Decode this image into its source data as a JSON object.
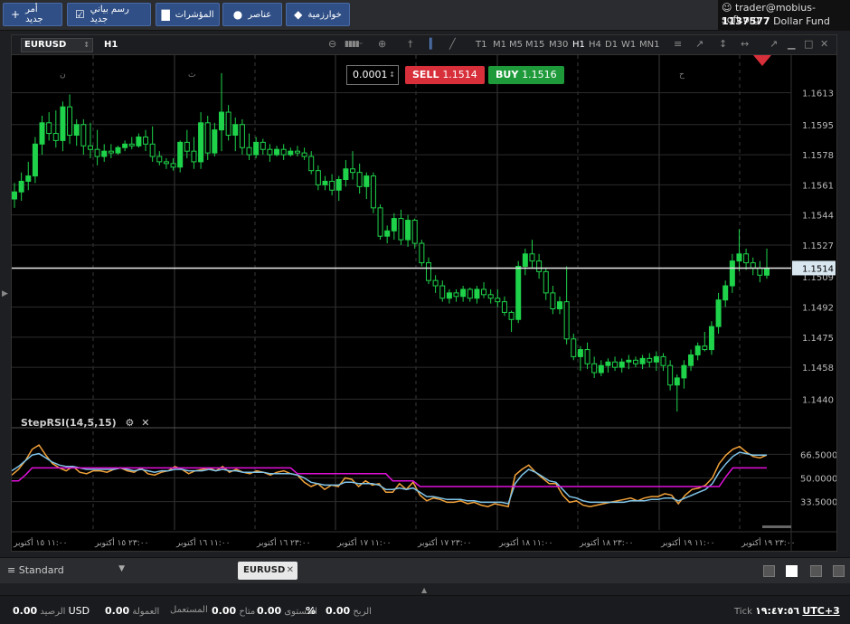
{
  "toolbar": {
    "new_order": "أمر جديد",
    "new_chart": "رسم بياني جديد",
    "indicators": "المؤشرات",
    "objects": "عناصر",
    "algorithms": "خوارزمية"
  },
  "account": {
    "user": "trader@mobius-soft.org",
    "number": "1137577",
    "name": "Dollar Fund"
  },
  "chart": {
    "symbol": "EURUSD",
    "timeframe": "H1",
    "timeframes": [
      "T1",
      "M1",
      "M5",
      "M15",
      "M30",
      "H1",
      "H4",
      "D1",
      "W1",
      "MN1"
    ],
    "active_timeframe": "H1",
    "lot": "0.0001",
    "sell_label": "SELL",
    "sell_price": "1.1514",
    "buy_label": "BUY",
    "buy_price": "1.1516",
    "current_price": "1.1514",
    "hidden_label": "1.1509",
    "day_markers": [
      "ن",
      "ث",
      "ح"
    ],
    "price_ticks": [
      "1.1613",
      "1.1595",
      "1.1578",
      "1.1561",
      "1.1544",
      "1.1527",
      "1.1492",
      "1.1475",
      "1.1458",
      "1.1440"
    ],
    "time_ticks": [
      "١١:٠٠ ١٥ أكتوبر",
      "٢٣:٠٠ ١٥ أكتوبر",
      "١١:٠٠ ١٦ أكتوبر",
      "٢٣:٠٠ ١٦ أكتوبر",
      "١١:٠٠ ١٧ أكتوبر",
      "٢٣:٠٠ ١٧ أكتوبر",
      "١١:٠٠ ١٨ أكتوبر",
      "٢٣:٠٠ ١٨ أكتوبر",
      "١١:٠٠ ١٩ أكتوبر",
      "٢٣:٠٠ ١٩ أكتوبر"
    ]
  },
  "chart_data": {
    "type": "candlestick",
    "ylim": [
      1.143,
      1.1625
    ],
    "candles": [
      [
        1.1553,
        1.1562,
        1.1548,
        1.1557
      ],
      [
        1.1557,
        1.1568,
        1.1552,
        1.1563
      ],
      [
        1.1563,
        1.1574,
        1.1558,
        1.1566
      ],
      [
        1.1566,
        1.1588,
        1.1562,
        1.1584
      ],
      [
        1.1584,
        1.16,
        1.1578,
        1.1596
      ],
      [
        1.1596,
        1.1602,
        1.1586,
        1.159
      ],
      [
        1.159,
        1.1603,
        1.1582,
        1.1586
      ],
      [
        1.1586,
        1.1608,
        1.158,
        1.1605
      ],
      [
        1.1605,
        1.1612,
        1.1584,
        1.1589
      ],
      [
        1.1589,
        1.1598,
        1.1583,
        1.1595
      ],
      [
        1.1595,
        1.1598,
        1.1578,
        1.1583
      ],
      [
        1.1583,
        1.1596,
        1.1576,
        1.1581
      ],
      [
        1.1581,
        1.1592,
        1.1572,
        1.1577
      ],
      [
        1.1577,
        1.1584,
        1.1574,
        1.158
      ],
      [
        1.158,
        1.1584,
        1.1576,
        1.1579
      ],
      [
        1.1579,
        1.1583,
        1.1578,
        1.1582
      ],
      [
        1.1582,
        1.1586,
        1.158,
        1.1584
      ],
      [
        1.1584,
        1.1588,
        1.1581,
        1.1583
      ],
      [
        1.1583,
        1.159,
        1.1582,
        1.1588
      ],
      [
        1.1588,
        1.1592,
        1.158,
        1.1584
      ],
      [
        1.1584,
        1.1594,
        1.1574,
        1.1577
      ],
      [
        1.1577,
        1.158,
        1.1572,
        1.1574
      ],
      [
        1.1574,
        1.1576,
        1.157,
        1.1573
      ],
      [
        1.1573,
        1.1576,
        1.1569,
        1.1571
      ],
      [
        1.1571,
        1.1586,
        1.1568,
        1.1585
      ],
      [
        1.1585,
        1.1592,
        1.1576,
        1.158
      ],
      [
        1.158,
        1.1588,
        1.157,
        1.1574
      ],
      [
        1.1574,
        1.1602,
        1.157,
        1.1596
      ],
      [
        1.1596,
        1.16,
        1.1575,
        1.1579
      ],
      [
        1.1579,
        1.1596,
        1.1577,
        1.1592
      ],
      [
        1.1592,
        1.1624,
        1.158,
        1.1602
      ],
      [
        1.1602,
        1.1606,
        1.1586,
        1.1589
      ],
      [
        1.1589,
        1.1599,
        1.158,
        1.1595
      ],
      [
        1.1595,
        1.1598,
        1.1578,
        1.1582
      ],
      [
        1.1582,
        1.159,
        1.1575,
        1.1578
      ],
      [
        1.1578,
        1.1588,
        1.1576,
        1.1585
      ],
      [
        1.1585,
        1.1587,
        1.1578,
        1.1581
      ],
      [
        1.1581,
        1.1584,
        1.1574,
        1.1578
      ],
      [
        1.1578,
        1.1583,
        1.1577,
        1.1581
      ],
      [
        1.1581,
        1.1584,
        1.1575,
        1.1578
      ],
      [
        1.1578,
        1.1582,
        1.1577,
        1.158
      ],
      [
        1.158,
        1.1583,
        1.1577,
        1.1579
      ],
      [
        1.1579,
        1.1582,
        1.1575,
        1.1577
      ],
      [
        1.1577,
        1.158,
        1.1567,
        1.1569
      ],
      [
        1.1569,
        1.1572,
        1.1558,
        1.1561
      ],
      [
        1.1561,
        1.1566,
        1.1558,
        1.1563
      ],
      [
        1.1563,
        1.1567,
        1.1555,
        1.1558
      ],
      [
        1.1558,
        1.1566,
        1.1552,
        1.1564
      ],
      [
        1.1564,
        1.1575,
        1.156,
        1.157
      ],
      [
        1.157,
        1.158,
        1.1564,
        1.1568
      ],
      [
        1.1568,
        1.1573,
        1.1556,
        1.156
      ],
      [
        1.156,
        1.1568,
        1.1553,
        1.1566
      ],
      [
        1.1566,
        1.1568,
        1.1545,
        1.1548
      ],
      [
        1.1548,
        1.155,
        1.153,
        1.1532
      ],
      [
        1.1532,
        1.1538,
        1.1528,
        1.1535
      ],
      [
        1.1535,
        1.1545,
        1.153,
        1.1542
      ],
      [
        1.1542,
        1.1547,
        1.1527,
        1.153
      ],
      [
        1.153,
        1.1544,
        1.1526,
        1.1541
      ],
      [
        1.1541,
        1.1542,
        1.1525,
        1.1528
      ],
      [
        1.1528,
        1.153,
        1.1515,
        1.1517
      ],
      [
        1.1517,
        1.152,
        1.1505,
        1.1507
      ],
      [
        1.1507,
        1.151,
        1.15,
        1.1504
      ],
      [
        1.1504,
        1.1507,
        1.1495,
        1.1497
      ],
      [
        1.1497,
        1.1502,
        1.1494,
        1.15
      ],
      [
        1.15,
        1.1502,
        1.1495,
        1.1498
      ],
      [
        1.1498,
        1.1504,
        1.1495,
        1.1502
      ],
      [
        1.1502,
        1.1503,
        1.1495,
        1.1497
      ],
      [
        1.1497,
        1.1504,
        1.1494,
        1.1502
      ],
      [
        1.1502,
        1.1506,
        1.1497,
        1.1499
      ],
      [
        1.1499,
        1.1502,
        1.1494,
        1.1497
      ],
      [
        1.1497,
        1.1502,
        1.1492,
        1.1495
      ],
      [
        1.1495,
        1.1498,
        1.1487,
        1.1489
      ],
      [
        1.1489,
        1.149,
        1.1478,
        1.1485
      ],
      [
        1.1485,
        1.1518,
        1.1483,
        1.1515
      ],
      [
        1.1515,
        1.1525,
        1.151,
        1.1522
      ],
      [
        1.1522,
        1.153,
        1.1514,
        1.1518
      ],
      [
        1.1518,
        1.1522,
        1.1508,
        1.1512
      ],
      [
        1.1512,
        1.1514,
        1.1496,
        1.15
      ],
      [
        1.15,
        1.1504,
        1.1488,
        1.1491
      ],
      [
        1.1491,
        1.1498,
        1.1488,
        1.1495
      ],
      [
        1.1495,
        1.1515,
        1.1471,
        1.1474
      ],
      [
        1.1474,
        1.1477,
        1.1462,
        1.1464
      ],
      [
        1.1464,
        1.147,
        1.1456,
        1.1468
      ],
      [
        1.1468,
        1.1472,
        1.1457,
        1.146
      ],
      [
        1.146,
        1.1464,
        1.1452,
        1.1455
      ],
      [
        1.1455,
        1.1462,
        1.1453,
        1.1459
      ],
      [
        1.1459,
        1.1463,
        1.1455,
        1.1461
      ],
      [
        1.1461,
        1.1464,
        1.1456,
        1.1458
      ],
      [
        1.1458,
        1.1463,
        1.1455,
        1.1461
      ],
      [
        1.1461,
        1.1465,
        1.1457,
        1.1462
      ],
      [
        1.1462,
        1.1464,
        1.1458,
        1.146
      ],
      [
        1.146,
        1.1465,
        1.1457,
        1.1463
      ],
      [
        1.1463,
        1.1466,
        1.1458,
        1.1461
      ],
      [
        1.1461,
        1.1467,
        1.1456,
        1.1464
      ],
      [
        1.1464,
        1.1466,
        1.1456,
        1.1459
      ],
      [
        1.1459,
        1.1462,
        1.1445,
        1.1448
      ],
      [
        1.1448,
        1.1454,
        1.1433,
        1.1452
      ],
      [
        1.1452,
        1.1462,
        1.1446,
        1.1459
      ],
      [
        1.1459,
        1.1468,
        1.1456,
        1.1465
      ],
      [
        1.1465,
        1.1472,
        1.1462,
        1.147
      ],
      [
        1.147,
        1.1478,
        1.1467,
        1.1468
      ],
      [
        1.1468,
        1.1484,
        1.1465,
        1.1481
      ],
      [
        1.1481,
        1.15,
        1.1477,
        1.1496
      ],
      [
        1.1496,
        1.1507,
        1.1492,
        1.1504
      ],
      [
        1.1504,
        1.1522,
        1.15,
        1.1518
      ],
      [
        1.1518,
        1.1536,
        1.1512,
        1.1522
      ],
      [
        1.1522,
        1.1525,
        1.1513,
        1.1517
      ],
      [
        1.1517,
        1.152,
        1.151,
        1.1514
      ],
      [
        1.1514,
        1.1518,
        1.1506,
        1.151
      ],
      [
        1.151,
        1.1525,
        1.1508,
        1.1514
      ]
    ],
    "indicator": {
      "name": "StepRSI(14,5,15)",
      "ticks": [
        "66.5000",
        "50.0000",
        "33.5000"
      ],
      "ylim": [
        20,
        80
      ],
      "orange": [
        52,
        56,
        62,
        70,
        73,
        66,
        60,
        57,
        55,
        58,
        54,
        53,
        55,
        55,
        54,
        56,
        57,
        55,
        54,
        57,
        53,
        52,
        54,
        55,
        58,
        56,
        53,
        55,
        56,
        57,
        55,
        58,
        54,
        56,
        54,
        53,
        55,
        54,
        52,
        54,
        55,
        53,
        52,
        47,
        44,
        46,
        42,
        45,
        44,
        50,
        49,
        44,
        48,
        45,
        46,
        40,
        40,
        46,
        42,
        47,
        38,
        34,
        36,
        35,
        33,
        33,
        34,
        32,
        33,
        31,
        30,
        32,
        31,
        30,
        52,
        56,
        59,
        54,
        50,
        46,
        46,
        38,
        33,
        34,
        31,
        30,
        31,
        32,
        33,
        34,
        35,
        36,
        34,
        36,
        37,
        37,
        39,
        38,
        32,
        38,
        42,
        43,
        45,
        50,
        60,
        66,
        70,
        72,
        68,
        65,
        64,
        66
      ],
      "blue": [
        55,
        58,
        62,
        66,
        67,
        64,
        61,
        59,
        58,
        58,
        57,
        56,
        56,
        56,
        56,
        56,
        57,
        56,
        55,
        56,
        55,
        54,
        55,
        55,
        56,
        56,
        55,
        55,
        55,
        56,
        55,
        56,
        55,
        55,
        54,
        54,
        54,
        54,
        53,
        53,
        53,
        53,
        52,
        50,
        47,
        46,
        45,
        45,
        45,
        47,
        47,
        46,
        46,
        46,
        45,
        42,
        42,
        43,
        42,
        43,
        40,
        37,
        37,
        36,
        35,
        35,
        35,
        34,
        34,
        33,
        33,
        33,
        33,
        32,
        46,
        52,
        56,
        54,
        51,
        48,
        47,
        42,
        37,
        36,
        34,
        33,
        33,
        33,
        33,
        33,
        33,
        34,
        34,
        34,
        35,
        35,
        36,
        36,
        34,
        36,
        38,
        40,
        42,
        46,
        54,
        60,
        65,
        68,
        67,
        66,
        66,
        66
      ],
      "magenta": [
        48,
        48,
        52,
        57,
        57,
        57,
        57,
        57,
        57,
        57,
        57,
        57,
        57,
        57,
        57,
        57,
        57,
        57,
        57,
        57,
        57,
        57,
        57,
        57,
        57,
        57,
        57,
        57,
        57,
        57,
        57,
        57,
        57,
        57,
        57,
        57,
        57,
        57,
        57,
        57,
        57,
        57,
        53,
        53,
        53,
        53,
        53,
        53,
        53,
        53,
        53,
        53,
        53,
        53,
        53,
        53,
        48,
        48,
        48,
        48,
        44,
        44,
        44,
        44,
        44,
        44,
        44,
        44,
        44,
        44,
        44,
        44,
        44,
        44,
        44,
        44,
        44,
        44,
        44,
        44,
        44,
        44,
        44,
        44,
        44,
        44,
        44,
        44,
        44,
        44,
        44,
        44,
        44,
        44,
        44,
        44,
        44,
        44,
        44,
        44,
        44,
        44,
        44,
        44,
        44,
        51,
        57,
        57,
        57,
        57,
        57,
        57
      ]
    }
  },
  "bottom": {
    "workspace": "Standard",
    "symbol_tab": "EURUSD"
  },
  "status": {
    "balance_label": "الرصيد",
    "balance": "0.00",
    "currency": "USD",
    "commission_label": "العمولة",
    "commission": "0.00",
    "used_label": "المستعمل",
    "used": "0.00",
    "available_label": "متاح",
    "available": "0.00",
    "level_label": "المستوى",
    "level": "%",
    "profit_label": "الربح",
    "profit": "0.00",
    "tick_label": "Tick",
    "clock": "١٩:٤٧:٥٦",
    "tz": "UTC+3"
  }
}
